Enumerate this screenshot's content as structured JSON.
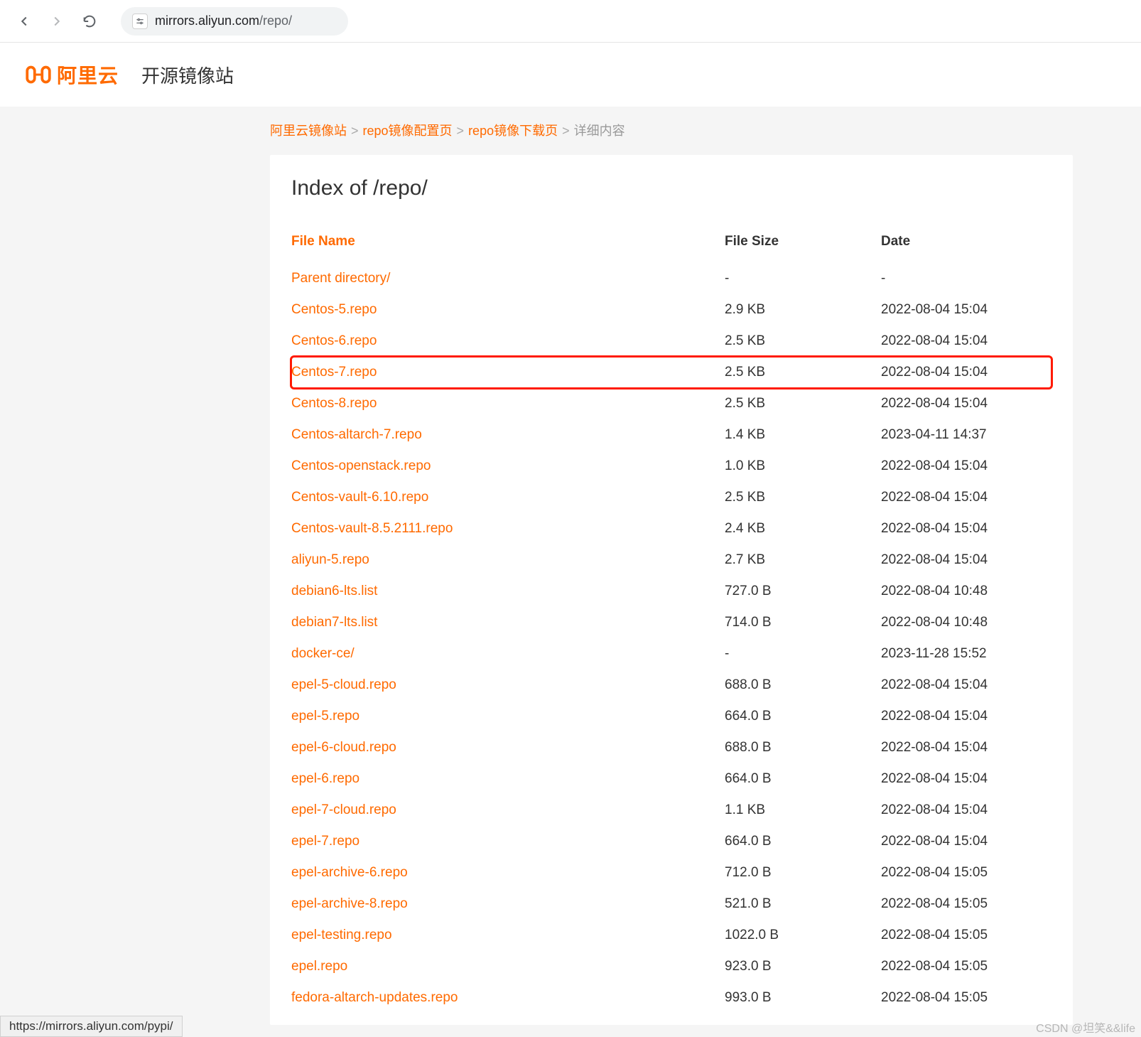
{
  "browser": {
    "domain": "mirrors.aliyun.com",
    "path": "/repo/"
  },
  "header": {
    "brand": "阿里云",
    "subtitle": "开源镜像站"
  },
  "breadcrumb": {
    "items": [
      {
        "label": "阿里云镜像站",
        "link": true
      },
      {
        "label": "repo镜像配置页",
        "link": true
      },
      {
        "label": "repo镜像下载页",
        "link": true
      },
      {
        "label": "详细内容",
        "link": false
      }
    ],
    "separator": ">"
  },
  "page": {
    "title": "Index of /repo/",
    "columns": {
      "name": "File Name",
      "size": "File Size",
      "date": "Date"
    },
    "files": [
      {
        "name": "Parent directory/",
        "size": "-",
        "date": "-",
        "highlight": false
      },
      {
        "name": "Centos-5.repo",
        "size": "2.9 KB",
        "date": "2022-08-04 15:04",
        "highlight": false
      },
      {
        "name": "Centos-6.repo",
        "size": "2.5 KB",
        "date": "2022-08-04 15:04",
        "highlight": false
      },
      {
        "name": "Centos-7.repo",
        "size": "2.5 KB",
        "date": "2022-08-04 15:04",
        "highlight": true
      },
      {
        "name": "Centos-8.repo",
        "size": "2.5 KB",
        "date": "2022-08-04 15:04",
        "highlight": false
      },
      {
        "name": "Centos-altarch-7.repo",
        "size": "1.4 KB",
        "date": "2023-04-11 14:37",
        "highlight": false
      },
      {
        "name": "Centos-openstack.repo",
        "size": "1.0 KB",
        "date": "2022-08-04 15:04",
        "highlight": false
      },
      {
        "name": "Centos-vault-6.10.repo",
        "size": "2.5 KB",
        "date": "2022-08-04 15:04",
        "highlight": false
      },
      {
        "name": "Centos-vault-8.5.2111.repo",
        "size": "2.4 KB",
        "date": "2022-08-04 15:04",
        "highlight": false
      },
      {
        "name": "aliyun-5.repo",
        "size": "2.7 KB",
        "date": "2022-08-04 15:04",
        "highlight": false
      },
      {
        "name": "debian6-lts.list",
        "size": "727.0 B",
        "date": "2022-08-04 10:48",
        "highlight": false
      },
      {
        "name": "debian7-lts.list",
        "size": "714.0 B",
        "date": "2022-08-04 10:48",
        "highlight": false
      },
      {
        "name": "docker-ce/",
        "size": "-",
        "date": "2023-11-28 15:52",
        "highlight": false
      },
      {
        "name": "epel-5-cloud.repo",
        "size": "688.0 B",
        "date": "2022-08-04 15:04",
        "highlight": false
      },
      {
        "name": "epel-5.repo",
        "size": "664.0 B",
        "date": "2022-08-04 15:04",
        "highlight": false
      },
      {
        "name": "epel-6-cloud.repo",
        "size": "688.0 B",
        "date": "2022-08-04 15:04",
        "highlight": false
      },
      {
        "name": "epel-6.repo",
        "size": "664.0 B",
        "date": "2022-08-04 15:04",
        "highlight": false
      },
      {
        "name": "epel-7-cloud.repo",
        "size": "1.1 KB",
        "date": "2022-08-04 15:04",
        "highlight": false
      },
      {
        "name": "epel-7.repo",
        "size": "664.0 B",
        "date": "2022-08-04 15:04",
        "highlight": false
      },
      {
        "name": "epel-archive-6.repo",
        "size": "712.0 B",
        "date": "2022-08-04 15:05",
        "highlight": false
      },
      {
        "name": "epel-archive-8.repo",
        "size": "521.0 B",
        "date": "2022-08-04 15:05",
        "highlight": false
      },
      {
        "name": "epel-testing.repo",
        "size": "1022.0 B",
        "date": "2022-08-04 15:05",
        "highlight": false
      },
      {
        "name": "epel.repo",
        "size": "923.0 B",
        "date": "2022-08-04 15:05",
        "highlight": false
      },
      {
        "name": "fedora-altarch-updates.repo",
        "size": "993.0 B",
        "date": "2022-08-04 15:05",
        "highlight": false
      }
    ]
  },
  "status": "https://mirrors.aliyun.com/pypi/",
  "watermark": "CSDN @坦笑&&life"
}
